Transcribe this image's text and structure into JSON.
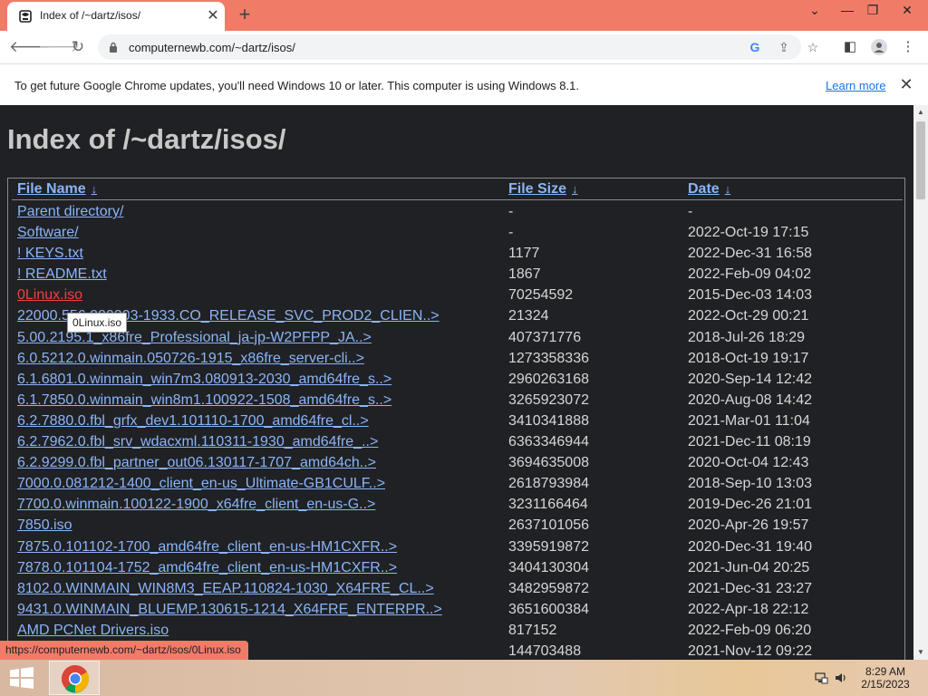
{
  "browser": {
    "tab_title": "Index of /~dartz/isos/",
    "url": "computernewb.com/~dartz/isos/",
    "status_url": "https://computernewb.com/~dartz/isos/0Linux.iso"
  },
  "infobar": {
    "message": "To get future Google Chrome updates, you'll need Windows 10 or later. This computer is using Windows 8.1.",
    "link": "Learn more"
  },
  "page": {
    "title": "Index of /~dartz/isos/",
    "columns": {
      "name": "File Name",
      "size": "File Size",
      "date": "Date",
      "sort_glyph": "↓"
    },
    "tooltip": "0Linux.iso",
    "rows": [
      {
        "name": "Parent directory/",
        "size": "-",
        "date": "-"
      },
      {
        "name": "Software/",
        "size": "-",
        "date": "2022-Oct-19 17:15"
      },
      {
        "name": "! KEYS.txt",
        "size": "1177",
        "date": "2022-Dec-31 16:58"
      },
      {
        "name": "! README.txt",
        "size": "1867",
        "date": "2022-Feb-09 04:02"
      },
      {
        "name": "0Linux.iso",
        "size": "70254592",
        "date": "2015-Dec-03 14:03",
        "active": true
      },
      {
        "name": "22000.556.220303-1933.CO_RELEASE_SVC_PROD2_CLIEN..>",
        "size": "21324",
        "date": "2022-Oct-29 00:21"
      },
      {
        "name": "5.00.2195.1_x86fre_Professional_ja-jp-W2PFPP_JA..>",
        "size": "407371776",
        "date": "2018-Jul-26 18:29"
      },
      {
        "name": "6.0.5212.0.winmain.050726-1915_x86fre_server-cli..>",
        "size": "1273358336",
        "date": "2018-Oct-19 19:17"
      },
      {
        "name": "6.1.6801.0.winmain_win7m3.080913-2030_amd64fre_s..>",
        "size": "2960263168",
        "date": "2020-Sep-14 12:42"
      },
      {
        "name": "6.1.7850.0.winmain_win8m1.100922-1508_amd64fre_s..>",
        "size": "3265923072",
        "date": "2020-Aug-08 14:42"
      },
      {
        "name": "6.2.7880.0.fbl_grfx_dev1.101110-1700_amd64fre_cl..>",
        "size": "3410341888",
        "date": "2021-Mar-01 11:04"
      },
      {
        "name": "6.2.7962.0.fbl_srv_wdacxml.110311-1930_amd64fre_..>",
        "size": "6363346944",
        "date": "2021-Dec-11 08:19"
      },
      {
        "name": "6.2.9299.0.fbl_partner_out06.130117-1707_amd64ch..>",
        "size": "3694635008",
        "date": "2020-Oct-04 12:43"
      },
      {
        "name": "7000.0.081212-1400_client_en-us_Ultimate-GB1CULF..>",
        "size": "2618793984",
        "date": "2018-Sep-10 13:03"
      },
      {
        "name": "7700.0.winmain.100122-1900_x64fre_client_en-us-G..>",
        "size": "3231166464",
        "date": "2019-Dec-26 21:01"
      },
      {
        "name": "7850.iso",
        "size": "2637101056",
        "date": "2020-Apr-26 19:57"
      },
      {
        "name": "7875.0.101102-1700_amd64fre_client_en-us-HM1CXFR..>",
        "size": "3395919872",
        "date": "2020-Dec-31 19:40"
      },
      {
        "name": "7878.0.101104-1752_amd64fre_client_en-us-HM1CXFR..>",
        "size": "3404130304",
        "date": "2021-Jun-04 20:25"
      },
      {
        "name": "8102.0.WINMAIN_WIN8M3_EEAP.110824-1030_X64FRE_CL..>",
        "size": "3482959872",
        "date": "2021-Dec-31 23:27"
      },
      {
        "name": "9431.0.WINMAIN_BLUEMP.130615-1214_X64FRE_ENTERPR..>",
        "size": "3651600384",
        "date": "2022-Apr-18 22:12"
      },
      {
        "name": "AMD PCNet Drivers.iso",
        "size": "817152",
        "date": "2022-Feb-09 06:20"
      },
      {
        "name": "",
        "size": "144703488",
        "date": "2021-Nov-12 09:22"
      }
    ]
  },
  "taskbar": {
    "time": "8:29 AM",
    "date": "2/15/2023"
  },
  "icons": {
    "favicon": "favicon-icon",
    "back": "back-arrow-icon",
    "forward": "forward-arrow-icon",
    "reload": "reload-icon",
    "lock": "lock-icon",
    "google": "google-icon",
    "share": "share-icon",
    "bookmark": "star-icon",
    "sidepanel": "side-panel-icon",
    "profile": "profile-icon",
    "menu": "kebab-menu-icon"
  },
  "colors": {
    "titlebar": "#f07c68",
    "page_bg": "#202124",
    "link": "#8ab4f8",
    "active_link": "#f04040"
  }
}
